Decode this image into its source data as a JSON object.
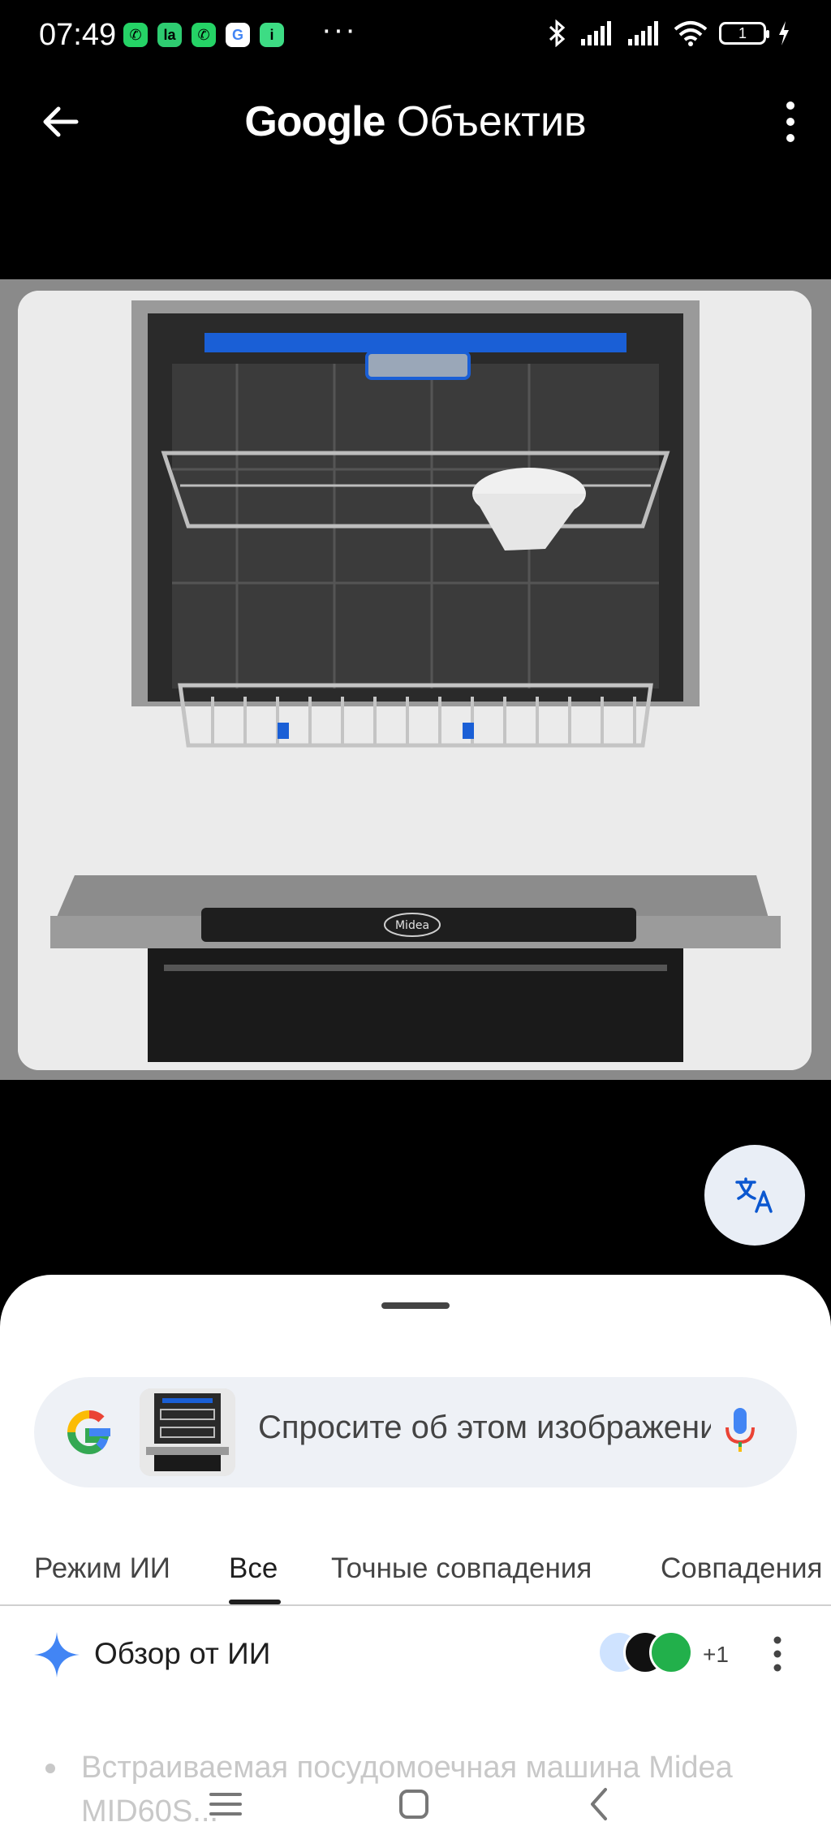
{
  "status_bar": {
    "time": "07:49",
    "more_notifications": "···",
    "battery_level": "1"
  },
  "app_bar": {
    "title_brand": "Google",
    "title_product": "Объектив"
  },
  "search": {
    "placeholder": "Спросите об этом изображении"
  },
  "tabs": [
    {
      "label": "Режим ИИ",
      "active": false
    },
    {
      "label": "Все",
      "active": true
    },
    {
      "label": "Точные совпадения",
      "active": false
    },
    {
      "label": "Совпадения",
      "active": false
    }
  ],
  "ai_overview": {
    "title": "Обзор от ИИ",
    "more_sources": "+1",
    "first_item_text": "Встраиваемая посудомоечная машина Midea MID60S..."
  },
  "image": {
    "brand_label": "Midea"
  },
  "colors": {
    "accent_blue": "#4285f4",
    "sheet_bg": "#ffffff",
    "search_bg": "#eef1f6"
  },
  "icons": {
    "back": "arrow-left-icon",
    "menu": "more-vert-icon",
    "translate": "translate-icon",
    "google": "google-g-icon",
    "mic": "mic-icon",
    "ai_spark": "gemini-spark-icon"
  }
}
